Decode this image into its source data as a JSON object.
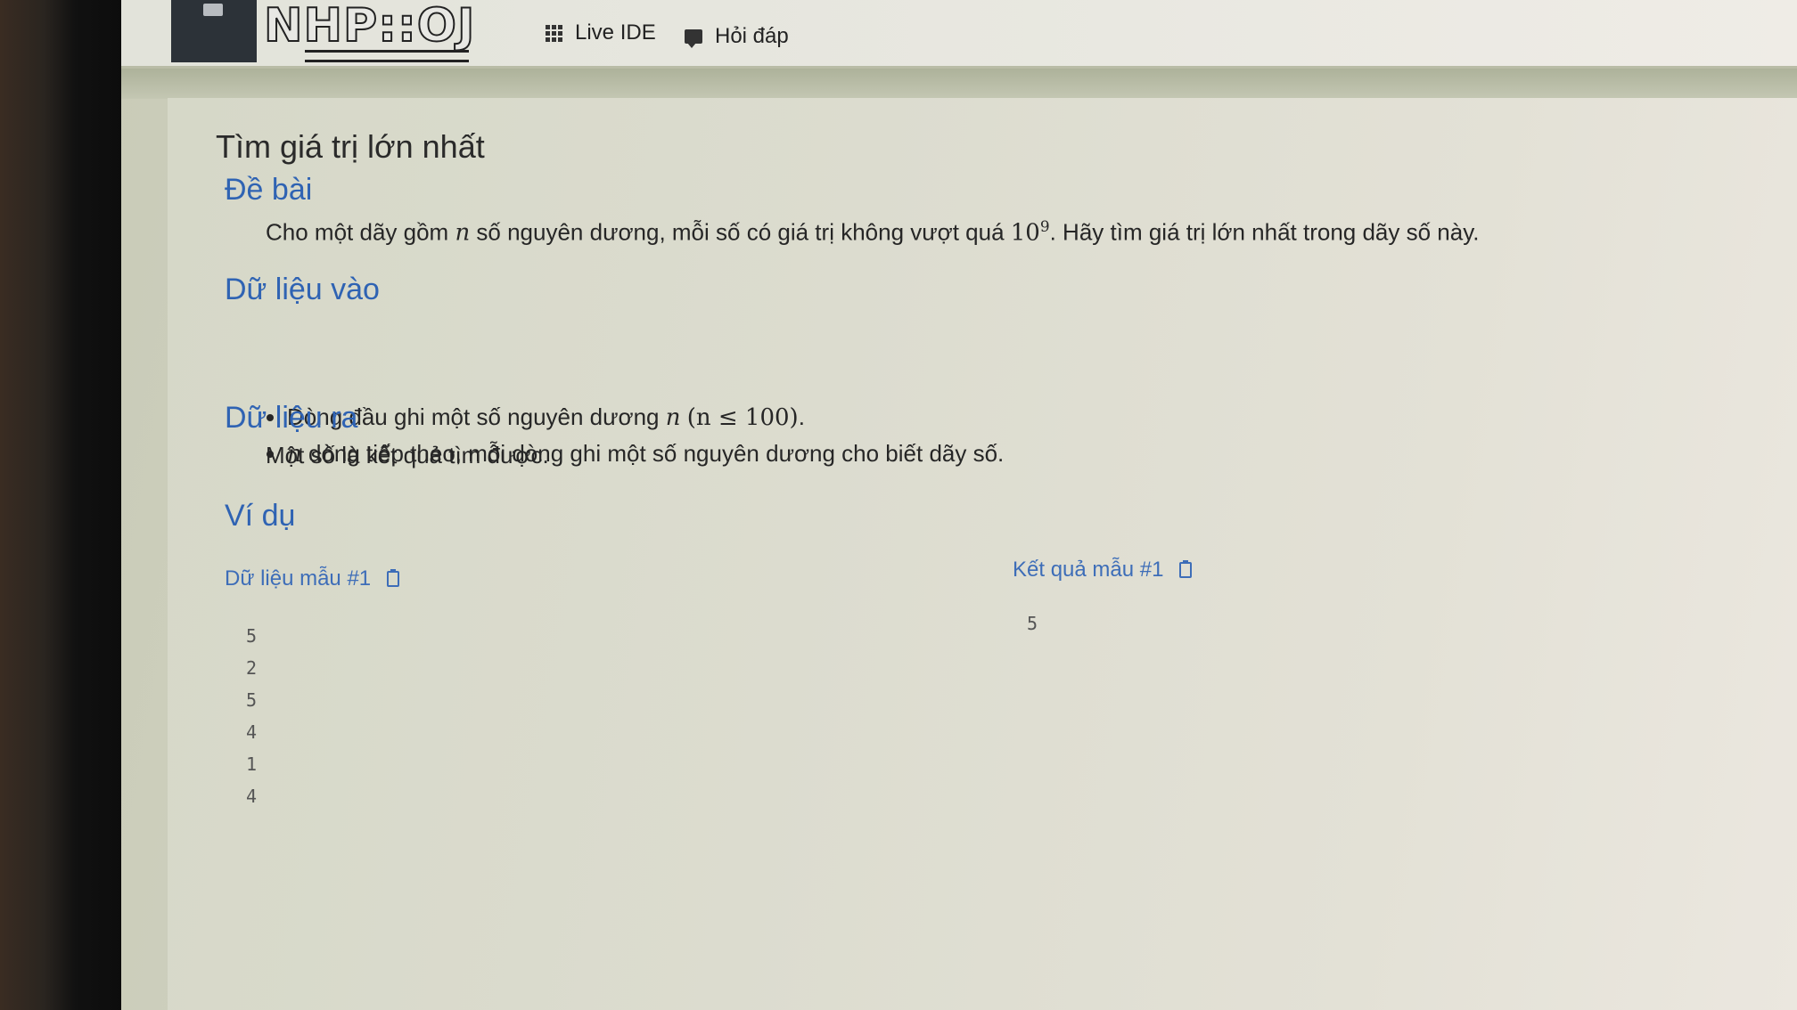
{
  "navbar": {
    "logo_text": "NHP::OJ",
    "items": [
      {
        "label": "Live IDE",
        "icon": "grid-icon"
      },
      {
        "label": "Hỏi đáp",
        "icon": "chat-icon"
      }
    ]
  },
  "problem": {
    "title": "Tìm giá trị lớn nhất",
    "sections": {
      "statement": {
        "heading": "Đề bài",
        "text_before_n": "Cho một dãy gồm ",
        "var_n": "n",
        "text_middle": " số nguyên dương, mỗi số có giá trị không vượt quá ",
        "power_base": "10",
        "power_exp": "9",
        "text_after": ". Hãy tìm giá trị lớn nhất trong dãy số này."
      },
      "input": {
        "heading": "Dữ liệu vào",
        "item1_text": "Dòng đầu ghi một số nguyên dương ",
        "item1_var": "n",
        "item1_constraint": "(n ≤ 100)",
        "item1_end": ".",
        "item2_var": "n",
        "item2_text": " dòng tiếp theo, mỗi dòng ghi một số nguyên dương cho biết dãy số."
      },
      "output": {
        "heading": "Dữ liệu ra",
        "text": "Một số là kết quả tìm được."
      },
      "example": {
        "heading": "Ví dụ",
        "input_label": "Dữ liệu mẫu #1",
        "output_label": "Kết quả mẫu #1",
        "input_lines": [
          "5",
          "2",
          "5",
          "4",
          "1",
          "4"
        ],
        "output_lines": [
          "5"
        ]
      }
    }
  },
  "colors": {
    "heading_blue": "#2f63b3",
    "link_blue": "#3d6db8"
  }
}
